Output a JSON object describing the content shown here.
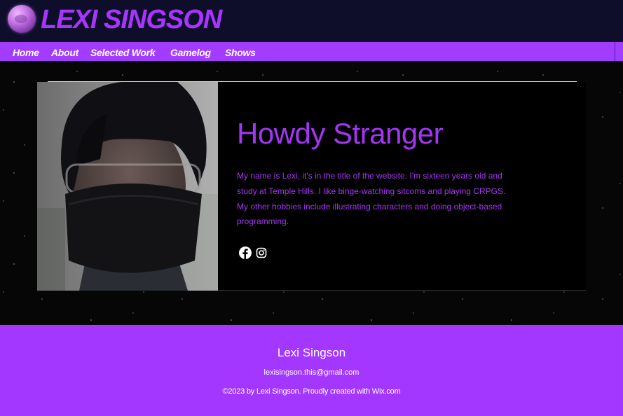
{
  "header": {
    "title": "LEXI SINGSON",
    "logo_icon": "planet-orb-logo-icon"
  },
  "nav": {
    "items": [
      {
        "label": "Home"
      },
      {
        "label": "About"
      },
      {
        "label": "Selected Work"
      },
      {
        "label": "Gamelog"
      },
      {
        "label": "Shows"
      }
    ]
  },
  "hero": {
    "heading": "Howdy Stranger",
    "body": "My name is Lexi, it's in the title of the website. I'm sixteen years old and study at Temple Hills. I like binge-watching sitcoms and playing CRPGS. My other hobbies include illustrating characters and doing object-based programming.",
    "photo_icon": "profile-photo",
    "social": [
      {
        "icon": "facebook-icon"
      },
      {
        "icon": "instagram-icon"
      }
    ]
  },
  "footer": {
    "name": "Lexi Singson",
    "email": "lexisingson.this@gmail.com",
    "copyright_prefix": "©2023 by Lexi Singson. Proudly created with ",
    "copyright_link": "Wix.com"
  },
  "colors": {
    "header_bg": "#0e0e2a",
    "accent": "#a23cff",
    "heading_text": "#a335f5",
    "hero_bg": "#000000"
  }
}
